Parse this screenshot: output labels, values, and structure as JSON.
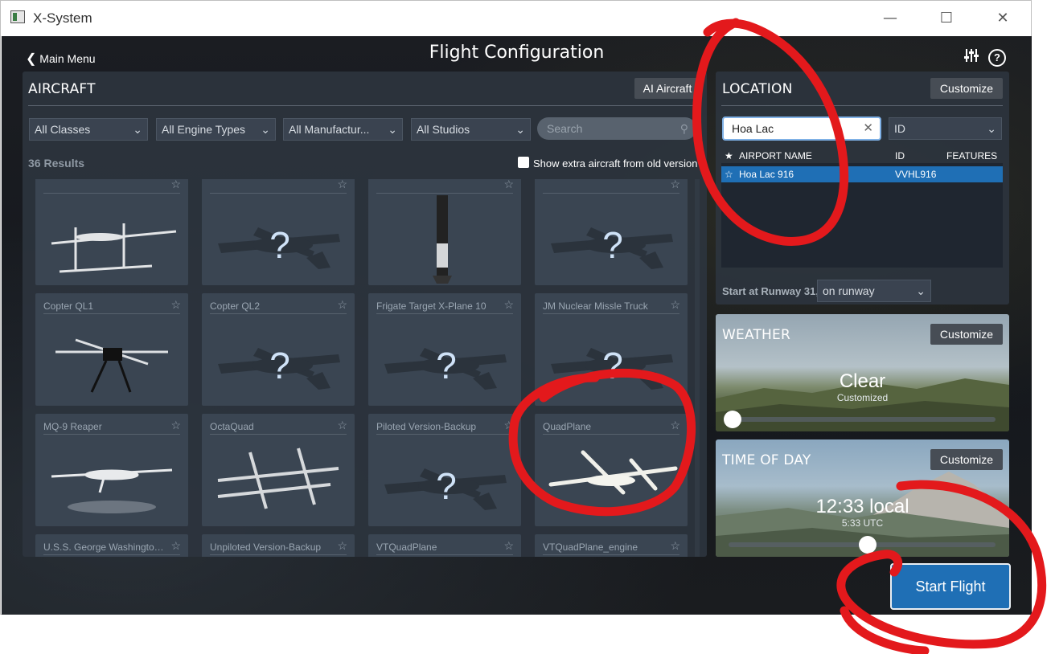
{
  "window": {
    "title": "X-System",
    "minimize": "—",
    "maximize": "☐",
    "close": "✕"
  },
  "header": {
    "back_label": "Main Menu",
    "title": "Flight Configuration"
  },
  "aircraft": {
    "title": "AIRCRAFT",
    "ai_button": "AI Aircraft",
    "filters": {
      "classes": "All Classes",
      "engines": "All Engine Types",
      "manufacturers": "All Manufactur...",
      "studios": "All Studios"
    },
    "search_placeholder": "Search",
    "results": "36 Results",
    "extra_label": "Show extra aircraft from old version",
    "cards": [
      {
        "name": "",
        "kind": "drone-twin"
      },
      {
        "name": "",
        "kind": "unknown"
      },
      {
        "name": "",
        "kind": "rocket"
      },
      {
        "name": "",
        "kind": "unknown"
      },
      {
        "name": "Copter QL1",
        "kind": "quadcopter"
      },
      {
        "name": "Copter QL2",
        "kind": "unknown"
      },
      {
        "name": "Frigate Target X-Plane 10",
        "kind": "unknown"
      },
      {
        "name": "JM Nuclear Missle Truck",
        "kind": "unknown"
      },
      {
        "name": "MQ-9 Reaper",
        "kind": "drone"
      },
      {
        "name": "OctaQuad",
        "kind": "octaquad"
      },
      {
        "name": "Piloted Version-Backup",
        "kind": "unknown"
      },
      {
        "name": "QuadPlane",
        "kind": "quadplane"
      },
      {
        "name": "U.S.S. George Washington (...",
        "kind": "none"
      },
      {
        "name": "Unpiloted Version-Backup",
        "kind": "none"
      },
      {
        "name": "VTQuadPlane",
        "kind": "none"
      },
      {
        "name": "VTQuadPlane_engine",
        "kind": "none"
      }
    ]
  },
  "location": {
    "title": "LOCATION",
    "customize": "Customize",
    "search_value": "Hoa Lac",
    "id_dropdown": "ID",
    "columns": {
      "airport": "AIRPORT NAME",
      "id": "ID",
      "features": "FEATURES"
    },
    "rows": [
      {
        "name": "Hoa Lac 916",
        "id": "VVHL916",
        "features": ""
      }
    ],
    "runway_label": "Start at Runway 31,",
    "runway_option": "on runway"
  },
  "weather": {
    "title": "WEATHER",
    "customize": "Customize",
    "value": "Clear",
    "sub": "Customized",
    "slider_fraction": 0.0
  },
  "time_of_day": {
    "title": "TIME OF DAY",
    "customize": "Customize",
    "value": "12:33 local",
    "sub": "5:33 UTC",
    "slider_fraction": 0.52
  },
  "start_flight": "Start Flight",
  "annotation_color": "#e3191c"
}
